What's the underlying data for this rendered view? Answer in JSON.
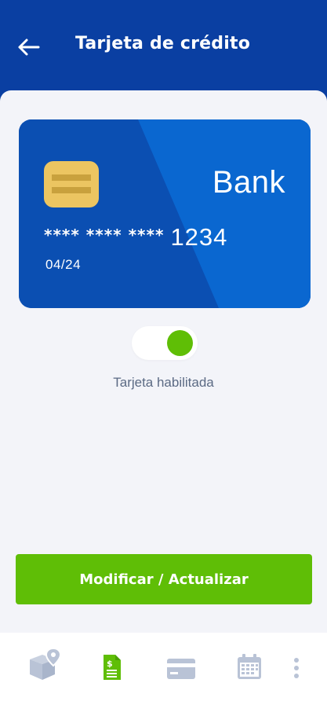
{
  "header": {
    "title": "Tarjeta de crédito",
    "back_icon": "arrow-left-icon"
  },
  "card": {
    "bank_name": "Bank",
    "masked_number": "**** **** ****",
    "last_digits": "1234",
    "expiry": "04/24",
    "chip_icon": "chip-icon"
  },
  "toggle": {
    "enabled": true,
    "label": "Tarjeta habilitada"
  },
  "actions": {
    "primary_label": "Modificar / Actualizar"
  },
  "bottom_nav": {
    "items": [
      {
        "icon": "package-location-icon",
        "active": false
      },
      {
        "icon": "receipt-dollar-icon",
        "active": true
      },
      {
        "icon": "credit-card-icon",
        "active": false
      },
      {
        "icon": "calendar-icon",
        "active": false
      },
      {
        "icon": "more-vertical-icon",
        "active": false
      }
    ]
  },
  "colors": {
    "primary_blue": "#0a3fa2",
    "card_blue": "#0b4fb2",
    "accent_green": "#5fbe06",
    "chip_gold": "#ecc561",
    "inactive_icon": "#b9c3d6",
    "background": "#f3f4f9"
  }
}
